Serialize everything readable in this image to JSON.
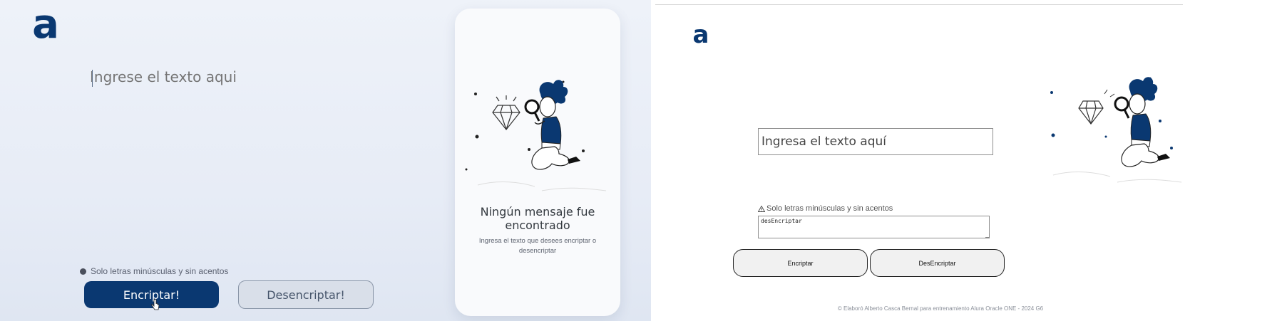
{
  "left": {
    "logo": "a",
    "input_placeholder": "Ingrese el texto aqui",
    "warning": "Solo letras minúsculas y sin acentos",
    "encrypt_label": "Encriptar!",
    "decrypt_label": "Desencriptar!",
    "output": {
      "title": "Ningún mensaje fue encontrado",
      "description": "Ingresa el texto que desees encriptar o desencriptar"
    }
  },
  "right": {
    "logo": "a",
    "input_placeholder": "Ingresa el texto aquí",
    "warning": "Solo letras minúsculas y sin acentos",
    "result_value": "desEncriptar",
    "encrypt_label": "Encriptar",
    "decrypt_label": "DesEncriptar",
    "footer": "© Elaboró Alberto Casca Bernal para entrenamiento Alura Oracle ONE - 2024 G6"
  },
  "colors": {
    "brand": "#0a3871",
    "left_bg": "#e9eef7",
    "card_bg": "#f9fafc"
  },
  "icons": {
    "warning_left": "info-dot-icon",
    "warning_right": "warning-triangle-icon",
    "cursor": "hand-pointer-icon"
  }
}
